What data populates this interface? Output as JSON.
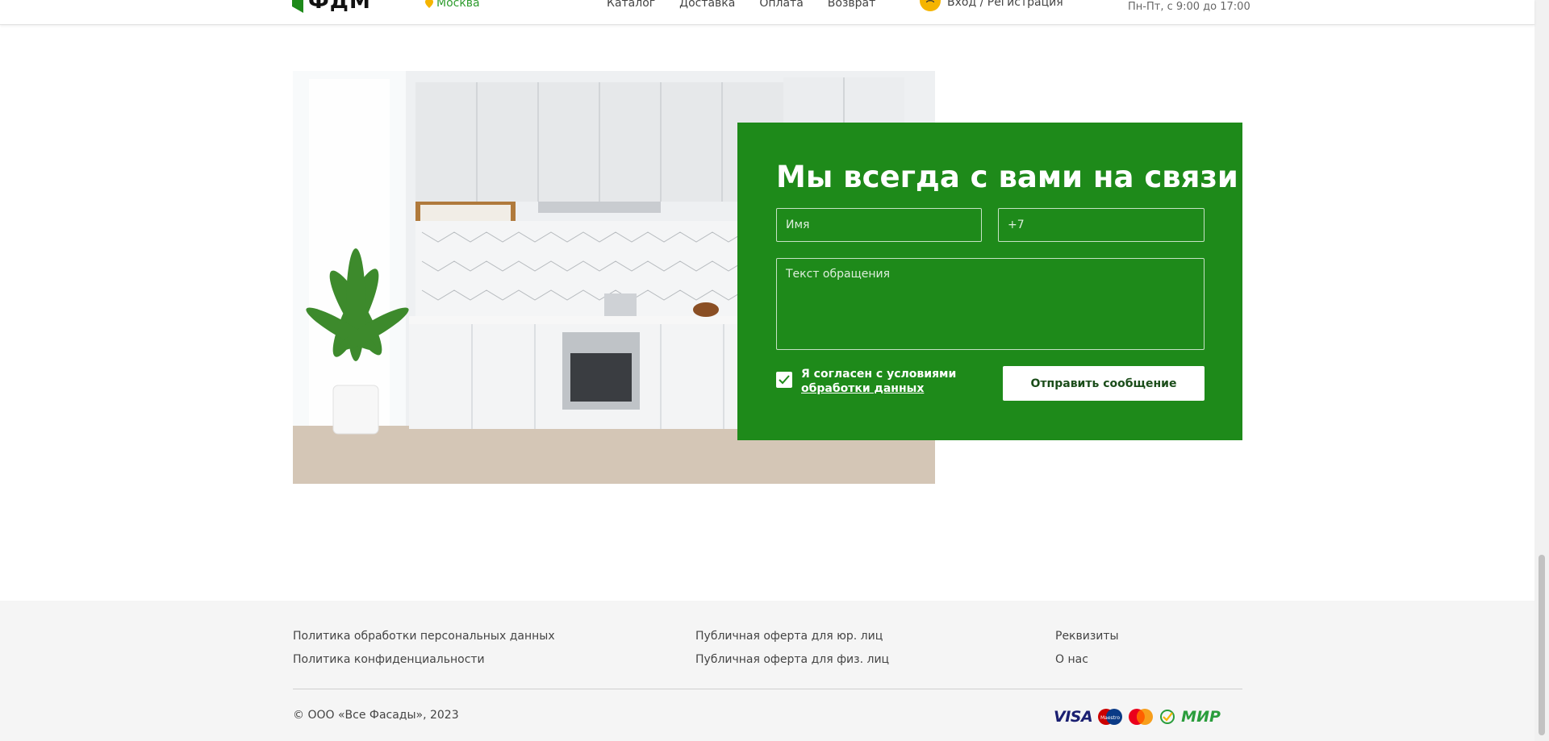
{
  "header": {
    "logo_text": "ФДМ",
    "city": "Москва",
    "nav": [
      "Каталог",
      "Доставка",
      "Оплата",
      "Возврат"
    ],
    "login": "Вход / Регистрация",
    "hours": "Пн-Пт, с 9:00 до 17:00"
  },
  "form": {
    "title": "Мы всегда с вами на связи",
    "name_placeholder": "Имя",
    "phone_placeholder": "+7",
    "message_placeholder": "Текст обращения",
    "agree_text": "Я согласен с условиями",
    "agree_link": "обработки данных",
    "agree_checked": true,
    "submit_label": "Отправить сообщение"
  },
  "footer": {
    "col1": [
      "Политика обработки персональных данных",
      "Политика конфиденциальности"
    ],
    "col2": [
      "Публичная оферта для юр. лиц",
      "Публичная оферта для физ. лиц"
    ],
    "col3": [
      "Реквизиты",
      "О нас"
    ],
    "copyright": "© ООО «Все Фасады», 2023",
    "payment_icons": [
      "visa-icon",
      "maestro-icon",
      "mastercard-icon",
      "sbp-icon",
      "mir-icon"
    ],
    "visa_text": "VISA",
    "maestro_text": "Maestro",
    "mir_text": "МИР"
  },
  "colors": {
    "brand_green": "#1e8a1a",
    "accent_yellow": "#f5b400",
    "footer_bg": "#f5f5f5"
  }
}
